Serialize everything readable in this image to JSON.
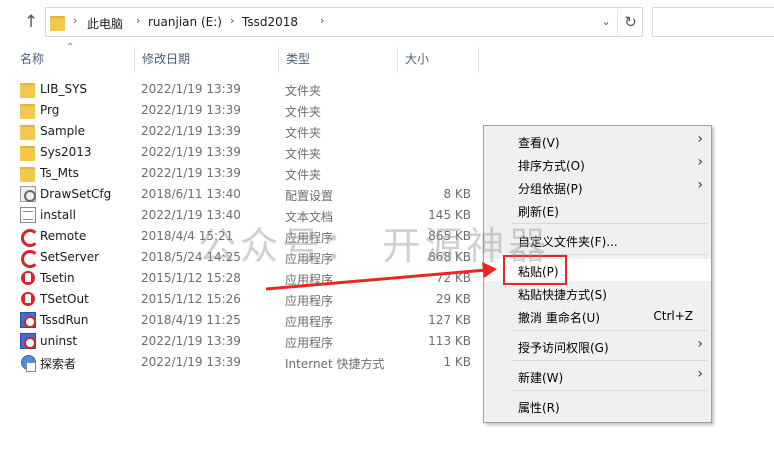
{
  "address_bar": {
    "breadcrumbs": [
      "此电脑",
      "ruanjian (E:)",
      "Tssd2018"
    ]
  },
  "columns": {
    "name": "名称",
    "date": "修改日期",
    "type": "类型",
    "size": "大小"
  },
  "files": [
    {
      "name": "LIB_SYS",
      "date": "2022/1/19 13:39",
      "type": "文件夹",
      "size": "",
      "icon": "folder-icon"
    },
    {
      "name": "Prg",
      "date": "2022/1/19 13:39",
      "type": "文件夹",
      "size": "",
      "icon": "folder-icon"
    },
    {
      "name": "Sample",
      "date": "2022/1/19 13:39",
      "type": "文件夹",
      "size": "",
      "icon": "folder-icon"
    },
    {
      "name": "Sys2013",
      "date": "2022/1/19 13:39",
      "type": "文件夹",
      "size": "",
      "icon": "folder-icon"
    },
    {
      "name": "Ts_Mts",
      "date": "2022/1/19 13:39",
      "type": "文件夹",
      "size": "",
      "icon": "folder-icon"
    },
    {
      "name": "DrawSetCfg",
      "date": "2018/6/11 13:40",
      "type": "配置设置",
      "size": "8 KB",
      "icon": "config-file-icon"
    },
    {
      "name": "install",
      "date": "2022/1/19 13:40",
      "type": "文本文档",
      "size": "145 KB",
      "icon": "text-file-icon"
    },
    {
      "name": "Remote",
      "date": "2018/4/4 15:21",
      "type": "应用程序",
      "size": "865 KB",
      "icon": "app-red-icon"
    },
    {
      "name": "SetServer",
      "date": "2018/5/24 14:25",
      "type": "应用程序",
      "size": "868 KB",
      "icon": "app-red-icon"
    },
    {
      "name": "Tsetin",
      "date": "2015/1/12 15:28",
      "type": "应用程序",
      "size": "72 KB",
      "icon": "app-red-solid-icon"
    },
    {
      "name": "TSetOut",
      "date": "2015/1/12 15:26",
      "type": "应用程序",
      "size": "29 KB",
      "icon": "app-red-solid-icon"
    },
    {
      "name": "TssdRun",
      "date": "2018/4/19 11:25",
      "type": "应用程序",
      "size": "127 KB",
      "icon": "app-blue-icon"
    },
    {
      "name": "uninst",
      "date": "2022/1/19 13:39",
      "type": "应用程序",
      "size": "113 KB",
      "icon": "app-blue-icon"
    },
    {
      "name": "探索者",
      "date": "2022/1/19 13:39",
      "type": "Internet 快捷方式",
      "size": "1 KB",
      "icon": "internet-shortcut-icon"
    }
  ],
  "context_menu": {
    "view": "查看(V)",
    "sort": "排序方式(O)",
    "group": "分组依据(P)",
    "refresh": "刷新(E)",
    "customize": "自定义文件夹(F)...",
    "paste": "粘贴(P)",
    "paste_shortcut": "粘贴快捷方式(S)",
    "undo_rename": "撤消 重命名(U)",
    "undo_shortcut": "Ctrl+Z",
    "grant_access": "授予访问权限(G)",
    "new": "新建(W)",
    "properties": "属性(R)"
  },
  "watermark": "公众号： 开源神器",
  "colors": {
    "accent_red": "#e8291f",
    "folder_yellow": "#f2c94c",
    "header_text": "#4c607a"
  }
}
